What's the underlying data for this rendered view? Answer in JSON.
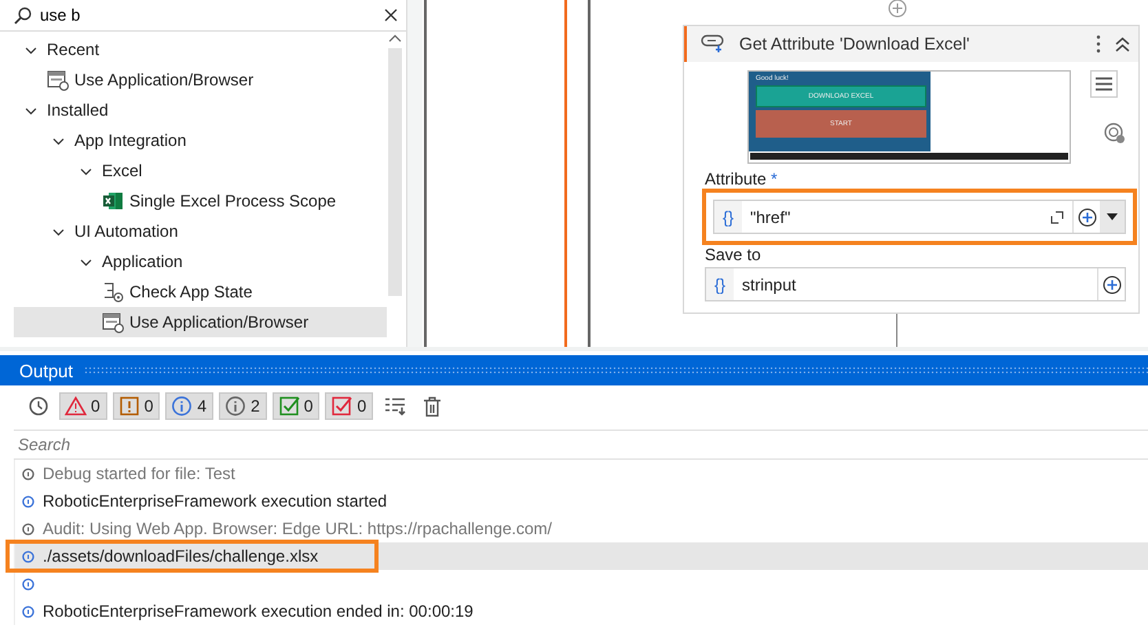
{
  "activities_panel": {
    "search": {
      "value": "use b"
    },
    "tree": [
      {
        "label": "Recent",
        "expanded": true,
        "selected": false,
        "children": [
          {
            "label": "Use Application/Browser",
            "kind": "browser",
            "selected": false
          }
        ]
      },
      {
        "label": "Installed",
        "expanded": true,
        "selected": false,
        "children": [
          {
            "label": "App Integration",
            "expanded": true,
            "selected": false,
            "children": [
              {
                "label": "Excel",
                "expanded": true,
                "selected": false,
                "children": [
                  {
                    "label": "Single Excel Process Scope",
                    "kind": "excel",
                    "selected": false
                  }
                ]
              }
            ]
          },
          {
            "label": "UI Automation",
            "expanded": true,
            "selected": false,
            "children": [
              {
                "label": "Application",
                "expanded": true,
                "selected": false,
                "children": [
                  {
                    "label": "Check App State",
                    "kind": "check",
                    "selected": false
                  },
                  {
                    "label": "Use Application/Browser",
                    "kind": "browser",
                    "selected": true
                  }
                ]
              }
            ]
          }
        ]
      }
    ]
  },
  "activity_card": {
    "title": "Get Attribute 'Download Excel'",
    "thumbnail": {
      "heading": "Good luck!",
      "primary_button": "DOWNLOAD EXCEL",
      "secondary_button": "START"
    },
    "fields": [
      {
        "label": "Attribute",
        "required_mark": "*",
        "type_badge": "{}",
        "value": "\"href\"",
        "has_dropdown": true,
        "highlighted": true
      },
      {
        "label": "Save to",
        "type_badge": "{}",
        "value": "strinput",
        "has_dropdown": false,
        "highlighted": false
      }
    ]
  },
  "output_panel": {
    "title": "Output",
    "filters": [
      {
        "kind": "warning",
        "count": "0",
        "on": true
      },
      {
        "kind": "error",
        "count": "0",
        "on": true
      },
      {
        "kind": "info",
        "count": "4",
        "on": true
      },
      {
        "kind": "trace",
        "count": "2",
        "on": true
      },
      {
        "kind": "success",
        "count": "0",
        "on": true
      },
      {
        "kind": "failure",
        "count": "0",
        "on": true
      }
    ],
    "search": {
      "placeholder": "Search"
    },
    "log": [
      {
        "kind": "trace",
        "message": "Debug started for file: Test",
        "selected": false,
        "highlighted": false
      },
      {
        "kind": "info",
        "message": "RoboticEnterpriseFramework execution started",
        "selected": false,
        "highlighted": false
      },
      {
        "kind": "trace",
        "message": "Audit: Using Web App. Browser: Edge URL: https://rpachallenge.com/",
        "selected": false,
        "highlighted": false
      },
      {
        "kind": "info",
        "message": "./assets/downloadFiles/challenge.xlsx",
        "selected": true,
        "highlighted": true
      },
      {
        "kind": "info",
        "selected": false,
        "highlighted": false
      },
      {
        "kind": "info",
        "message": "RoboticEnterpriseFramework execution ended in: 00:00:19",
        "selected": false,
        "highlighted": false
      }
    ]
  }
}
